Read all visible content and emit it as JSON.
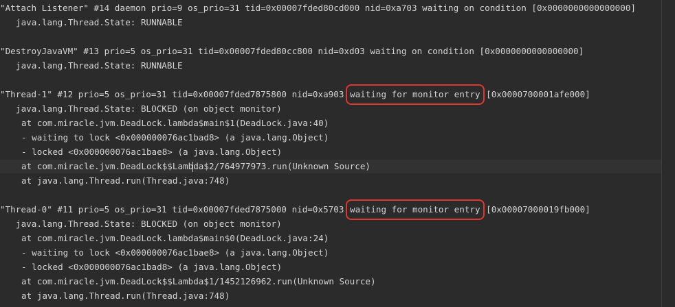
{
  "colors": {
    "background": "#2b2b2b",
    "text": "#d4d4d4",
    "highlight_box": "#e0382c"
  },
  "lines": {
    "l1": "\"Attach Listener\" #14 daemon prio=9 os_prio=31 tid=0x00007fded80cd000 nid=0xa703 waiting on condition [0x0000000000000000]",
    "l2": "java.lang.Thread.State: RUNNABLE",
    "l3": "\"DestroyJavaVM\" #13 prio=5 os_prio=31 tid=0x00007fded80cc800 nid=0xd03 waiting on condition [0x0000000000000000]",
    "l4": "java.lang.Thread.State: RUNNABLE",
    "l5_pre": "\"Thread-1\" #12 prio=5 os_prio=31 tid=0x00007fded7875800 nid=0xa903 ",
    "l5_hl": "waiting for monitor entry",
    "l5_post": " [0x0000700001afe000]",
    "l6": "java.lang.Thread.State: BLOCKED (on object monitor)",
    "l7": "at com.miracle.jvm.DeadLock.lambda$main$1(DeadLock.java:40)",
    "l8": "- waiting to lock <0x000000076ac1bad8> (a java.lang.Object)",
    "l9": "- locked <0x000000076ac1bae8> (a java.lang.Object)",
    "l10_a": "at com.miracle.jvm.DeadLock$$Lamb",
    "l10_b": "da$2/764977973.run(Unknown Source)",
    "l11": "at java.lang.Thread.run(Thread.java:748)",
    "l12_pre": "\"Thread-0\" #11 prio=5 os_prio=31 tid=0x00007fded7875000 nid=0x5703 ",
    "l12_hl": "waiting for monitor entry",
    "l12_post": " [0x00007000019fb000]",
    "l13": "java.lang.Thread.State: BLOCKED (on object monitor)",
    "l14": "at com.miracle.jvm.DeadLock.lambda$main$0(DeadLock.java:24)",
    "l15": "- waiting to lock <0x000000076ac1bae8> (a java.lang.Object)",
    "l16": "- locked <0x000000076ac1bad8> (a java.lang.Object)",
    "l17": "at com.miracle.jvm.DeadLock$$Lambda$1/1452126962.run(Unknown Source)",
    "l18": "at java.lang.Thread.run(Thread.java:748)"
  }
}
